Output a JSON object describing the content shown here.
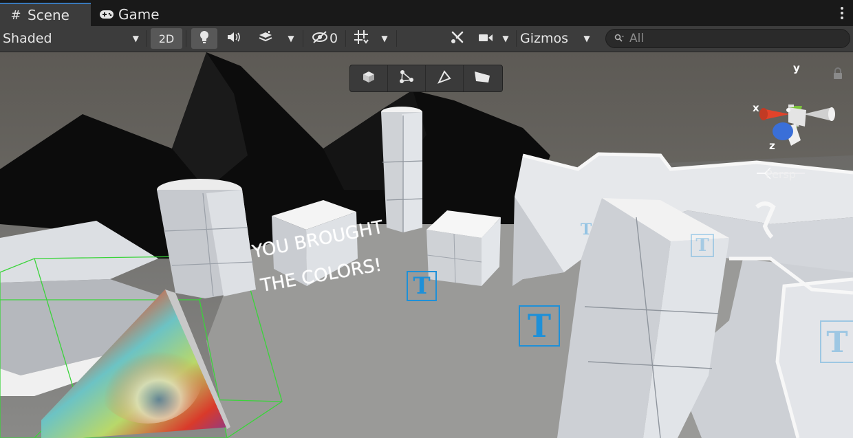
{
  "tabs": [
    {
      "label": "Scene",
      "icon": "hash-grid-icon",
      "active": true
    },
    {
      "label": "Game",
      "icon": "gamepad-icon",
      "active": false
    }
  ],
  "toolbar": {
    "draw_mode": "Shaded",
    "mode_2d": "2D",
    "hidden_count": "0",
    "gizmos": "Gizmos",
    "search_placeholder": "All"
  },
  "tools": [
    "cube-icon",
    "nodes-icon",
    "triangle-icon",
    "plane-icon"
  ],
  "overlay": {
    "line1": "YOU BROUGHT",
    "line2": "THE COLORS!",
    "projection": "Persp",
    "axis_x": "x",
    "axis_y": "y",
    "axis_z": "z",
    "text_icon_glyph": "T"
  },
  "colors": {
    "tab_accent": "#3a79bb",
    "text_gizmo": "#1e90d8",
    "axis_x": "#e2432a",
    "axis_y": "#7ac23a",
    "axis_z": "#3a6fd8",
    "selection": "#3ad43a"
  }
}
